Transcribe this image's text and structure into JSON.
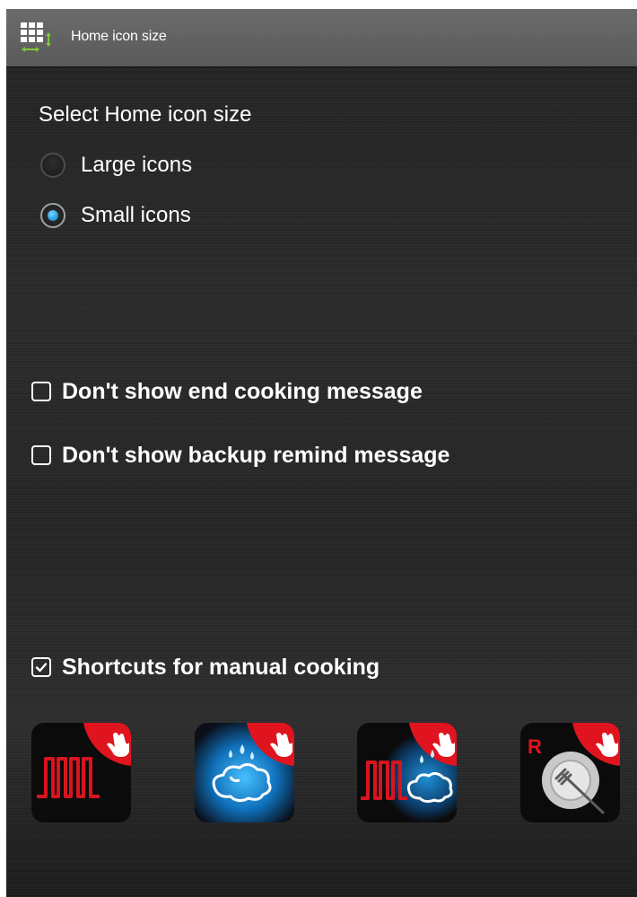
{
  "header": {
    "title": "Home icon size",
    "icon": "grid-resize-icon"
  },
  "icon_size": {
    "heading": "Select Home icon size",
    "options": [
      {
        "label": "Large icons",
        "selected": false
      },
      {
        "label": "Small icons",
        "selected": true
      }
    ]
  },
  "settings": {
    "end_cooking": {
      "label": "Don't show end cooking message",
      "checked": false
    },
    "backup_remind": {
      "label": "Don't show backup remind message",
      "checked": false
    },
    "shortcuts": {
      "label": "Shortcuts for manual cooking",
      "checked": true
    }
  },
  "shortcut_tiles": [
    {
      "icon": "heating-element-icon"
    },
    {
      "icon": "steam-icon"
    },
    {
      "icon": "combi-heat-steam-icon"
    },
    {
      "icon": "regenerate-plate-icon",
      "badge": "R"
    }
  ],
  "colors": {
    "accent_blue": "#2ba3e8",
    "tile_red": "#e0141e",
    "steam_blue": "#1f9fea"
  }
}
